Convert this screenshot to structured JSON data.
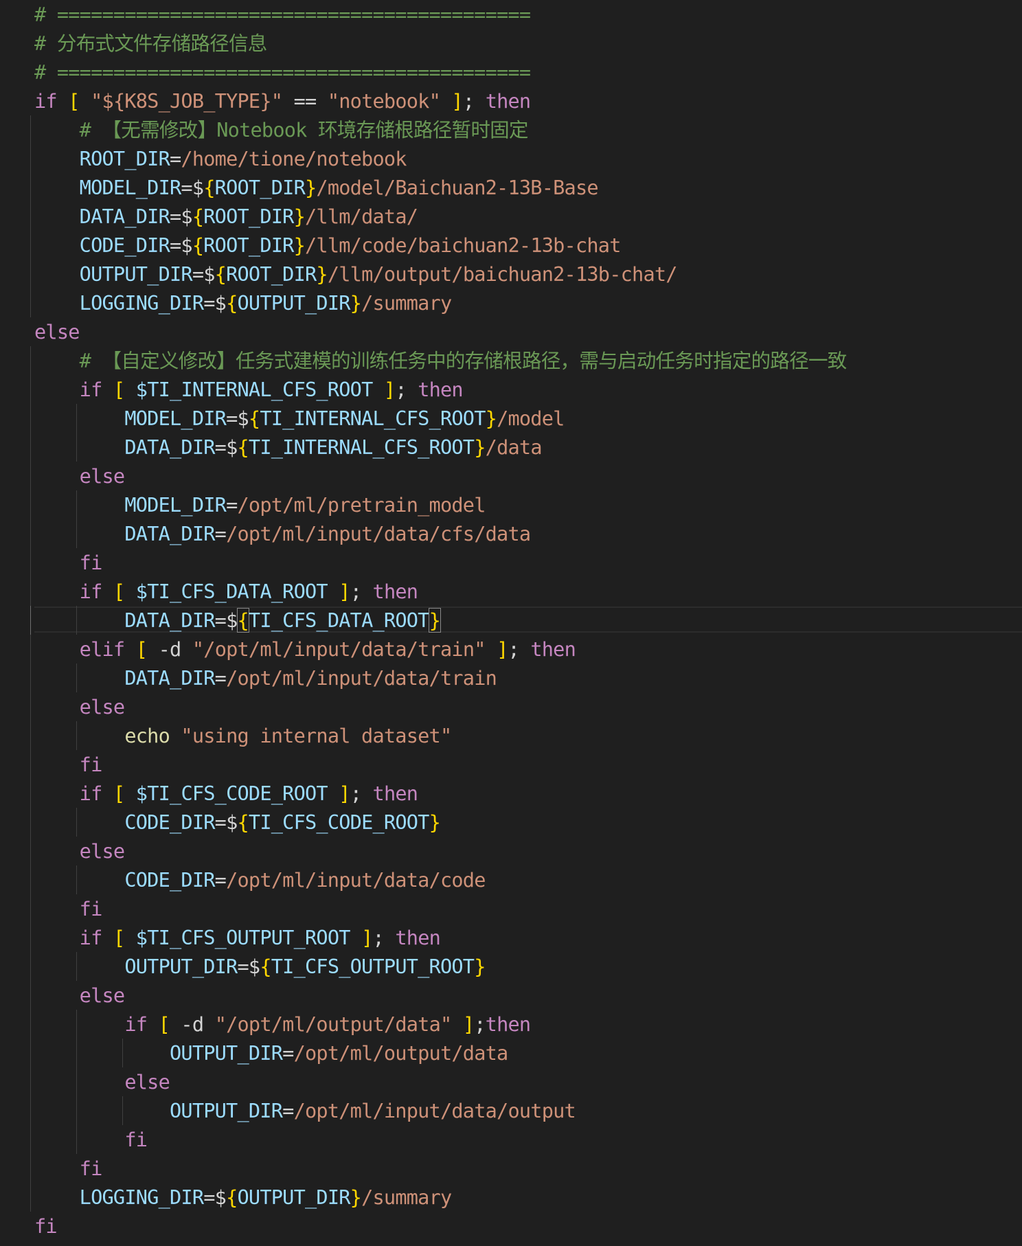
{
  "editor": {
    "language": "shell",
    "cursor_line": 22,
    "indent_guide_offset_chars": [
      0,
      4,
      8
    ],
    "colors": {
      "background": "#1f1f1f",
      "comment": "#6a9955",
      "keyword": "#c586c0",
      "variable": "#9cdcfe",
      "operator": "#d4d4d4",
      "bracket": "#ffd700",
      "string": "#ce9178",
      "function": "#dcdcaa"
    },
    "lines": [
      {
        "guides": 0,
        "tokens": [
          [
            "cmt",
            "# =========================================="
          ]
        ]
      },
      {
        "guides": 0,
        "tokens": [
          [
            "cmt",
            "# 分布式文件存储路径信息"
          ]
        ]
      },
      {
        "guides": 0,
        "tokens": [
          [
            "cmt",
            "# =========================================="
          ]
        ]
      },
      {
        "guides": 0,
        "tokens": [
          [
            "kw",
            "if"
          ],
          [
            "op",
            " "
          ],
          [
            "br",
            "["
          ],
          [
            "op",
            " "
          ],
          [
            "str",
            "\"${K8S_JOB_TYPE}\""
          ],
          [
            "op",
            " == "
          ],
          [
            "str",
            "\"notebook\""
          ],
          [
            "op",
            " "
          ],
          [
            "br",
            "]"
          ],
          [
            "op",
            "; "
          ],
          [
            "kw",
            "then"
          ]
        ]
      },
      {
        "guides": 1,
        "tokens": [
          [
            "op",
            "    "
          ],
          [
            "cmt",
            "# 【无需修改】Notebook 环境存储根路径暂时固定"
          ]
        ]
      },
      {
        "guides": 1,
        "tokens": [
          [
            "op",
            "    "
          ],
          [
            "var",
            "ROOT_DIR"
          ],
          [
            "op",
            "="
          ],
          [
            "str",
            "/home/tione/notebook"
          ]
        ]
      },
      {
        "guides": 1,
        "tokens": [
          [
            "op",
            "    "
          ],
          [
            "var",
            "MODEL_DIR"
          ],
          [
            "op",
            "=$"
          ],
          [
            "br",
            "{"
          ],
          [
            "var",
            "ROOT_DIR"
          ],
          [
            "br",
            "}"
          ],
          [
            "str",
            "/model/Baichuan2-13B-Base"
          ]
        ]
      },
      {
        "guides": 1,
        "tokens": [
          [
            "op",
            "    "
          ],
          [
            "var",
            "DATA_DIR"
          ],
          [
            "op",
            "=$"
          ],
          [
            "br",
            "{"
          ],
          [
            "var",
            "ROOT_DIR"
          ],
          [
            "br",
            "}"
          ],
          [
            "str",
            "/llm/data/"
          ]
        ]
      },
      {
        "guides": 1,
        "tokens": [
          [
            "op",
            "    "
          ],
          [
            "var",
            "CODE_DIR"
          ],
          [
            "op",
            "=$"
          ],
          [
            "br",
            "{"
          ],
          [
            "var",
            "ROOT_DIR"
          ],
          [
            "br",
            "}"
          ],
          [
            "str",
            "/llm/code/baichuan2-13b-chat"
          ]
        ]
      },
      {
        "guides": 1,
        "tokens": [
          [
            "op",
            "    "
          ],
          [
            "var",
            "OUTPUT_DIR"
          ],
          [
            "op",
            "=$"
          ],
          [
            "br",
            "{"
          ],
          [
            "var",
            "ROOT_DIR"
          ],
          [
            "br",
            "}"
          ],
          [
            "str",
            "/llm/output/baichuan2-13b-chat/"
          ]
        ]
      },
      {
        "guides": 1,
        "tokens": [
          [
            "op",
            "    "
          ],
          [
            "var",
            "LOGGING_DIR"
          ],
          [
            "op",
            "=$"
          ],
          [
            "br",
            "{"
          ],
          [
            "var",
            "OUTPUT_DIR"
          ],
          [
            "br",
            "}"
          ],
          [
            "str",
            "/summary"
          ]
        ]
      },
      {
        "guides": 0,
        "tokens": [
          [
            "kw",
            "else"
          ]
        ]
      },
      {
        "guides": 1,
        "tokens": [
          [
            "op",
            "    "
          ],
          [
            "cmt",
            "# 【自定义修改】任务式建模的训练任务中的存储根路径，需与启动任务时指定的路径一致"
          ]
        ]
      },
      {
        "guides": 1,
        "tokens": [
          [
            "op",
            "    "
          ],
          [
            "kw",
            "if"
          ],
          [
            "op",
            " "
          ],
          [
            "br",
            "["
          ],
          [
            "op",
            " "
          ],
          [
            "var",
            "$TI_INTERNAL_CFS_ROOT"
          ],
          [
            "op",
            " "
          ],
          [
            "br",
            "]"
          ],
          [
            "op",
            "; "
          ],
          [
            "kw",
            "then"
          ]
        ]
      },
      {
        "guides": 2,
        "tokens": [
          [
            "op",
            "        "
          ],
          [
            "var",
            "MODEL_DIR"
          ],
          [
            "op",
            "=$"
          ],
          [
            "br",
            "{"
          ],
          [
            "var",
            "TI_INTERNAL_CFS_ROOT"
          ],
          [
            "br",
            "}"
          ],
          [
            "str",
            "/model"
          ]
        ]
      },
      {
        "guides": 2,
        "tokens": [
          [
            "op",
            "        "
          ],
          [
            "var",
            "DATA_DIR"
          ],
          [
            "op",
            "=$"
          ],
          [
            "br",
            "{"
          ],
          [
            "var",
            "TI_INTERNAL_CFS_ROOT"
          ],
          [
            "br",
            "}"
          ],
          [
            "str",
            "/data"
          ]
        ]
      },
      {
        "guides": 1,
        "tokens": [
          [
            "op",
            "    "
          ],
          [
            "kw",
            "else"
          ]
        ]
      },
      {
        "guides": 2,
        "tokens": [
          [
            "op",
            "        "
          ],
          [
            "var",
            "MODEL_DIR"
          ],
          [
            "op",
            "="
          ],
          [
            "str",
            "/opt/ml/pretrain_model"
          ]
        ]
      },
      {
        "guides": 2,
        "tokens": [
          [
            "op",
            "        "
          ],
          [
            "var",
            "DATA_DIR"
          ],
          [
            "op",
            "="
          ],
          [
            "str",
            "/opt/ml/input/data/cfs/data"
          ]
        ]
      },
      {
        "guides": 1,
        "tokens": [
          [
            "op",
            "    "
          ],
          [
            "kw",
            "fi"
          ]
        ]
      },
      {
        "guides": 1,
        "tokens": [
          [
            "op",
            "    "
          ],
          [
            "kw",
            "if"
          ],
          [
            "op",
            " "
          ],
          [
            "br",
            "["
          ],
          [
            "op",
            " "
          ],
          [
            "var",
            "$TI_CFS_DATA_ROOT"
          ],
          [
            "op",
            " "
          ],
          [
            "br",
            "]"
          ],
          [
            "op",
            "; "
          ],
          [
            "kw",
            "then"
          ]
        ]
      },
      {
        "guides": 2,
        "active_guide": 1,
        "tokens": [
          [
            "op",
            "        "
          ],
          [
            "var",
            "DATA_DIR"
          ],
          [
            "op",
            "=$"
          ],
          [
            "br-match",
            "{"
          ],
          [
            "var",
            "TI_CFS_DATA_ROOT"
          ],
          [
            "br-match",
            "}"
          ]
        ]
      },
      {
        "guides": 1,
        "tokens": [
          [
            "op",
            "    "
          ],
          [
            "kw",
            "elif"
          ],
          [
            "op",
            " "
          ],
          [
            "br",
            "["
          ],
          [
            "op",
            " -d "
          ],
          [
            "str",
            "\"/opt/ml/input/data/train\""
          ],
          [
            "op",
            " "
          ],
          [
            "br",
            "]"
          ],
          [
            "op",
            "; "
          ],
          [
            "kw",
            "then"
          ]
        ]
      },
      {
        "guides": 2,
        "tokens": [
          [
            "op",
            "        "
          ],
          [
            "var",
            "DATA_DIR"
          ],
          [
            "op",
            "="
          ],
          [
            "str",
            "/opt/ml/input/data/train"
          ]
        ]
      },
      {
        "guides": 1,
        "tokens": [
          [
            "op",
            "    "
          ],
          [
            "kw",
            "else"
          ]
        ]
      },
      {
        "guides": 2,
        "tokens": [
          [
            "op",
            "        "
          ],
          [
            "fn",
            "echo"
          ],
          [
            "op",
            " "
          ],
          [
            "str",
            "\"using internal dataset\""
          ]
        ]
      },
      {
        "guides": 1,
        "tokens": [
          [
            "op",
            "    "
          ],
          [
            "kw",
            "fi"
          ]
        ]
      },
      {
        "guides": 1,
        "tokens": [
          [
            "op",
            "    "
          ],
          [
            "kw",
            "if"
          ],
          [
            "op",
            " "
          ],
          [
            "br",
            "["
          ],
          [
            "op",
            " "
          ],
          [
            "var",
            "$TI_CFS_CODE_ROOT"
          ],
          [
            "op",
            " "
          ],
          [
            "br",
            "]"
          ],
          [
            "op",
            "; "
          ],
          [
            "kw",
            "then"
          ]
        ]
      },
      {
        "guides": 2,
        "tokens": [
          [
            "op",
            "        "
          ],
          [
            "var",
            "CODE_DIR"
          ],
          [
            "op",
            "=$"
          ],
          [
            "br",
            "{"
          ],
          [
            "var",
            "TI_CFS_CODE_ROOT"
          ],
          [
            "br",
            "}"
          ]
        ]
      },
      {
        "guides": 1,
        "tokens": [
          [
            "op",
            "    "
          ],
          [
            "kw",
            "else"
          ]
        ]
      },
      {
        "guides": 2,
        "tokens": [
          [
            "op",
            "        "
          ],
          [
            "var",
            "CODE_DIR"
          ],
          [
            "op",
            "="
          ],
          [
            "str",
            "/opt/ml/input/data/code"
          ]
        ]
      },
      {
        "guides": 1,
        "tokens": [
          [
            "op",
            "    "
          ],
          [
            "kw",
            "fi"
          ]
        ]
      },
      {
        "guides": 1,
        "tokens": [
          [
            "op",
            "    "
          ],
          [
            "kw",
            "if"
          ],
          [
            "op",
            " "
          ],
          [
            "br",
            "["
          ],
          [
            "op",
            " "
          ],
          [
            "var",
            "$TI_CFS_OUTPUT_ROOT"
          ],
          [
            "op",
            " "
          ],
          [
            "br",
            "]"
          ],
          [
            "op",
            "; "
          ],
          [
            "kw",
            "then"
          ]
        ]
      },
      {
        "guides": 2,
        "tokens": [
          [
            "op",
            "        "
          ],
          [
            "var",
            "OUTPUT_DIR"
          ],
          [
            "op",
            "=$"
          ],
          [
            "br",
            "{"
          ],
          [
            "var",
            "TI_CFS_OUTPUT_ROOT"
          ],
          [
            "br",
            "}"
          ]
        ]
      },
      {
        "guides": 1,
        "tokens": [
          [
            "op",
            "    "
          ],
          [
            "kw",
            "else"
          ]
        ]
      },
      {
        "guides": 2,
        "tokens": [
          [
            "op",
            "        "
          ],
          [
            "kw",
            "if"
          ],
          [
            "op",
            " "
          ],
          [
            "br",
            "["
          ],
          [
            "op",
            " -d "
          ],
          [
            "str",
            "\"/opt/ml/output/data\""
          ],
          [
            "op",
            " "
          ],
          [
            "br",
            "]"
          ],
          [
            "op",
            ";"
          ],
          [
            "kw",
            "then"
          ]
        ]
      },
      {
        "guides": 3,
        "tokens": [
          [
            "op",
            "            "
          ],
          [
            "var",
            "OUTPUT_DIR"
          ],
          [
            "op",
            "="
          ],
          [
            "str",
            "/opt/ml/output/data"
          ]
        ]
      },
      {
        "guides": 2,
        "tokens": [
          [
            "op",
            "        "
          ],
          [
            "kw",
            "else"
          ]
        ]
      },
      {
        "guides": 3,
        "tokens": [
          [
            "op",
            "            "
          ],
          [
            "var",
            "OUTPUT_DIR"
          ],
          [
            "op",
            "="
          ],
          [
            "str",
            "/opt/ml/input/data/output"
          ]
        ]
      },
      {
        "guides": 2,
        "tokens": [
          [
            "op",
            "        "
          ],
          [
            "kw",
            "fi"
          ]
        ]
      },
      {
        "guides": 1,
        "tokens": [
          [
            "op",
            "    "
          ],
          [
            "kw",
            "fi"
          ]
        ]
      },
      {
        "guides": 1,
        "tokens": [
          [
            "op",
            "    "
          ],
          [
            "var",
            "LOGGING_DIR"
          ],
          [
            "op",
            "=$"
          ],
          [
            "br",
            "{"
          ],
          [
            "var",
            "OUTPUT_DIR"
          ],
          [
            "br",
            "}"
          ],
          [
            "str",
            "/summary"
          ]
        ]
      },
      {
        "guides": 0,
        "tokens": [
          [
            "kw",
            "fi"
          ]
        ]
      }
    ]
  }
}
